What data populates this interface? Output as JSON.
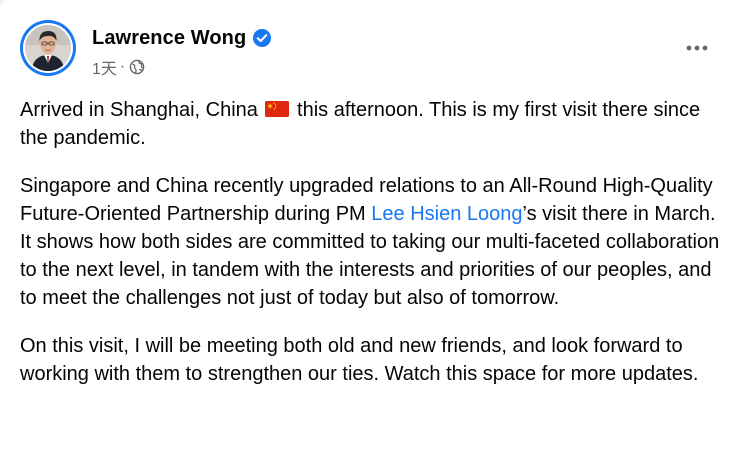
{
  "post": {
    "author": {
      "name": "Lawrence Wong",
      "verified": true
    },
    "meta": {
      "time": "1天",
      "separator": "·",
      "audience_icon": "globe-icon"
    },
    "more_icon": "more-options-icon",
    "paragraphs": {
      "p1": {
        "before_flag": "Arrived in Shanghai, China ",
        "flag_icon": "china-flag-icon",
        "after_flag": " this afternoon. This is my first visit there since the pandemic."
      },
      "p2": {
        "before_link": "Singapore and China recently upgraded relations to an All-Round High-Quality Future-Oriented Partnership during PM ",
        "link_text": "Lee Hsien Loong",
        "after_link": "’s visit there in March. It shows how both sides are committed to taking our multi-faceted collaboration to the next level, in tandem with the interests and priorities of our peoples, and to meet the challenges not just of today but also of tomorrow."
      },
      "p3": {
        "text": "On this visit, I will be meeting both old and new friends, and look forward to working with them to strengthen our ties. Watch this space for more updates."
      }
    }
  },
  "colors": {
    "accent": "#1877f2",
    "text": "#050505",
    "secondary_text": "#65676b",
    "background": "#ffffff"
  }
}
